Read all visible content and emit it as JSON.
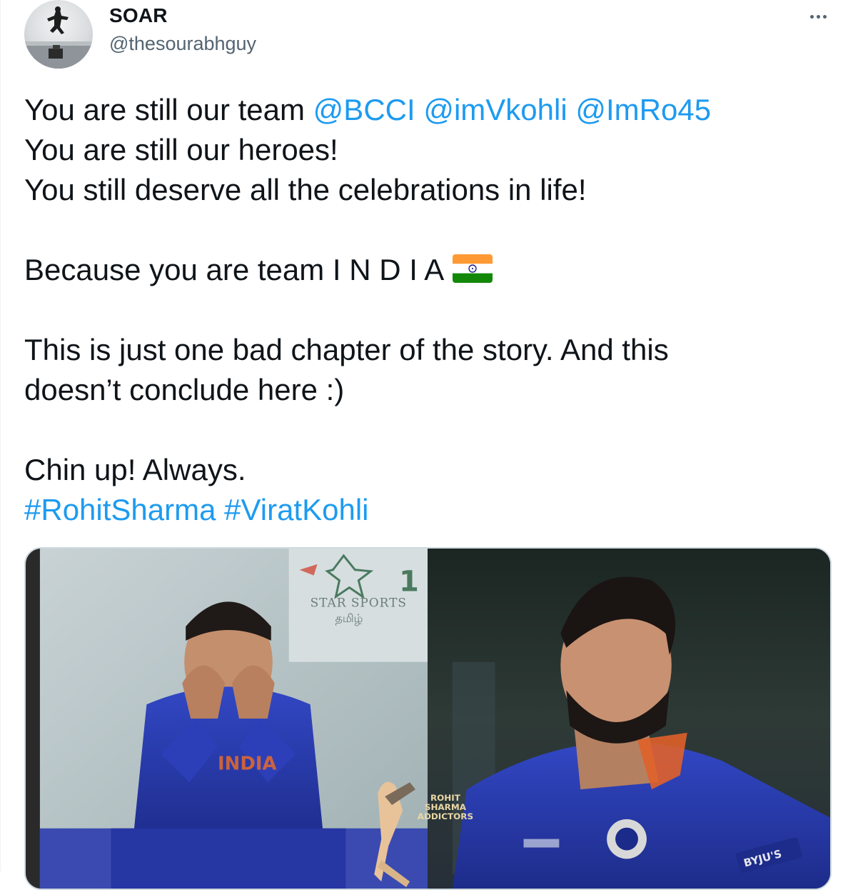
{
  "author": {
    "display_name": "SOAR",
    "handle": "@thesourabhguy"
  },
  "tweet": {
    "line1_text": "You are still our team ",
    "mentions": [
      "@BCCI",
      "@imVkohli",
      "@ImRo45"
    ],
    "line2": "You are still our heroes!",
    "line3": "You still deserve all the celebrations in life!",
    "line4": "Because you are team I N D I A",
    "line5": "This is just one bad chapter of the story. And this",
    "line6": "doesn’t conclude here :)",
    "line7": "Chin up! Always.",
    "hashtags": [
      "#RohitSharma",
      "#ViratKohli"
    ]
  },
  "media": {
    "overlay_channel": "STAR SPORTS",
    "overlay_channel_sub": "தமிழ்",
    "overlay_channel_num": "1",
    "watermark_lines": [
      "ROHIT",
      "SHARMA",
      "ADDICTORS"
    ],
    "jersey_text": "INDIA",
    "sleeve_text": "BYJU'S"
  },
  "colors": {
    "link": "#1d9bf0",
    "text": "#0f1419",
    "secondary": "#536471",
    "jersey_blue": "#2a3fb0"
  },
  "icons": {
    "more": "more-horizontal-icon",
    "flag": "india-flag-emoji"
  }
}
